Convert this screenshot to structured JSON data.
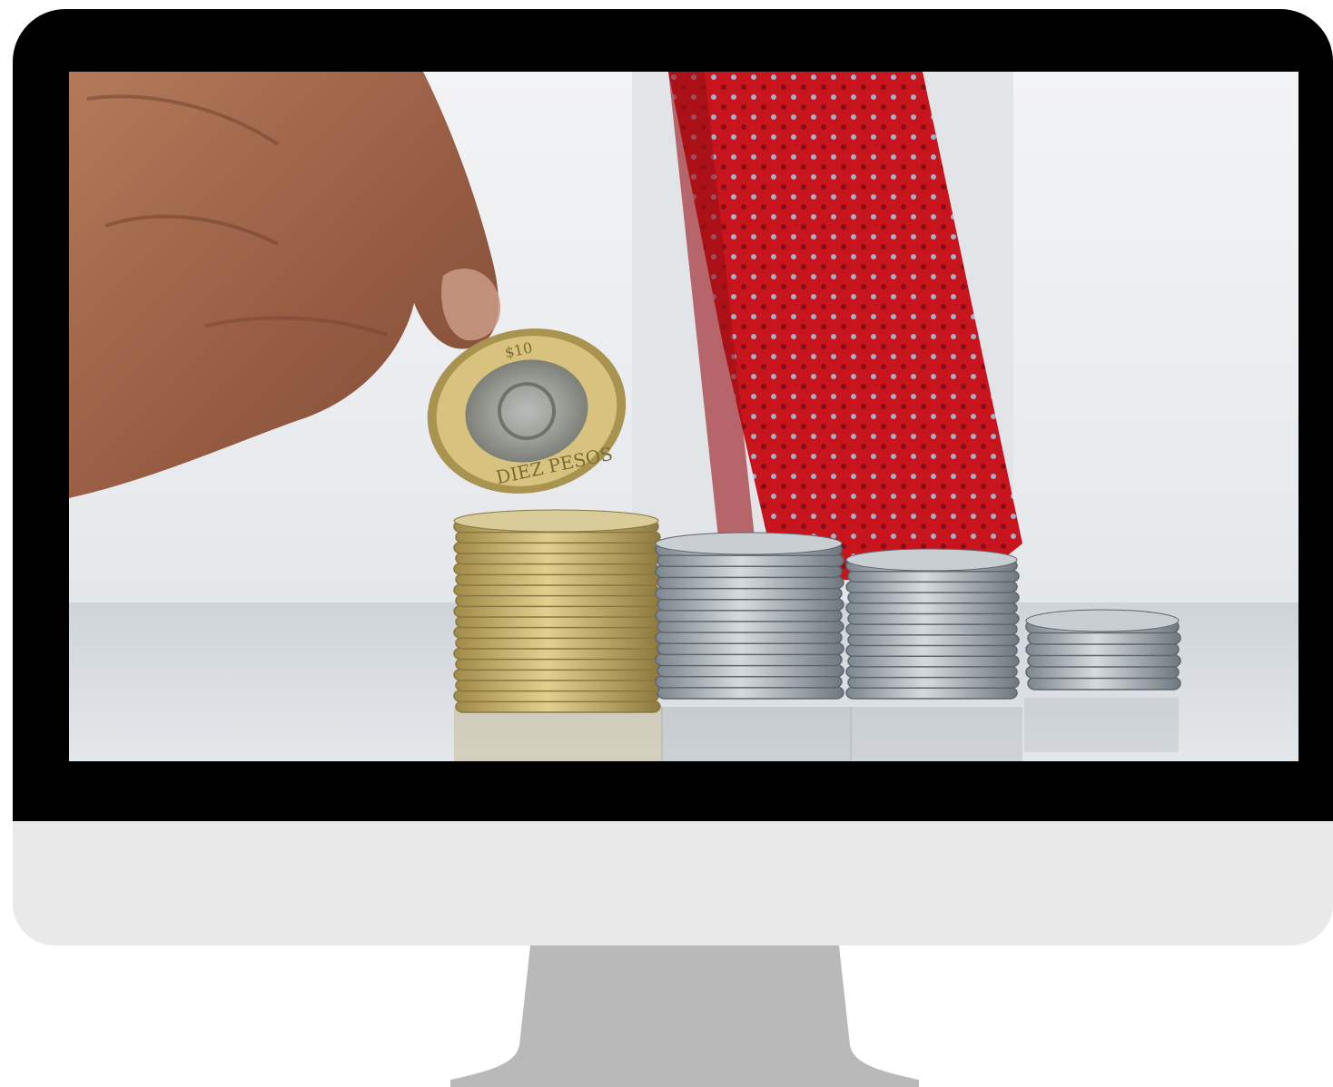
{
  "device": "desktop-monitor",
  "screen": {
    "scene": "photo",
    "coin_text": [
      "DIEZ PESOS",
      "$10"
    ]
  },
  "colors": {
    "bezel": "#000000",
    "chin": "#e9e9e9",
    "stand": "#b9b9b9",
    "tie": "#c8141c",
    "gold_coin": "#c9b36e",
    "silver_coin": "#aeb6bc"
  }
}
